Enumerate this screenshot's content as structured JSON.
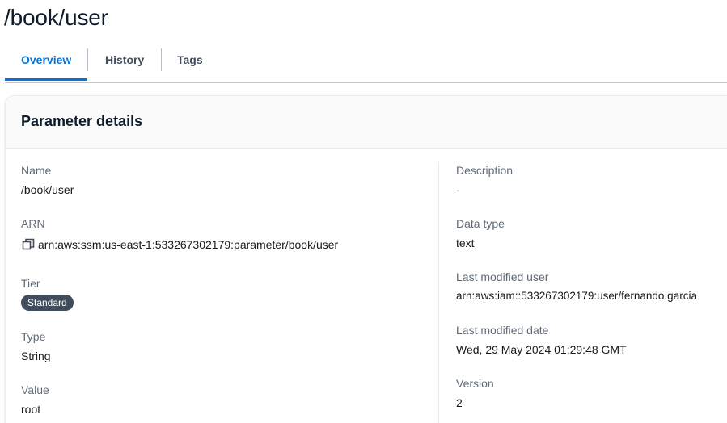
{
  "header": {
    "title": "/book/user"
  },
  "tabs": [
    {
      "label": "Overview",
      "active": true
    },
    {
      "label": "History",
      "active": false
    },
    {
      "label": "Tags",
      "active": false
    }
  ],
  "panel": {
    "title": "Parameter details"
  },
  "left_column": {
    "name": {
      "label": "Name",
      "value": "/book/user"
    },
    "arn": {
      "label": "ARN",
      "value": "arn:aws:ssm:us-east-1:533267302179:parameter/book/user",
      "icon": "copy-icon"
    },
    "tier": {
      "label": "Tier",
      "value": "Standard"
    },
    "type": {
      "label": "Type",
      "value": "String"
    },
    "value": {
      "label": "Value",
      "value": "root"
    }
  },
  "right_column": {
    "description": {
      "label": "Description",
      "value": "-"
    },
    "data_type": {
      "label": "Data type",
      "value": "text"
    },
    "last_modified_user": {
      "label": "Last modified user",
      "value": "arn:aws:iam::533267302179:user/fernando.garcia"
    },
    "last_modified_date": {
      "label": "Last modified date",
      "value": "Wed, 29 May 2024 01:29:48 GMT"
    },
    "version": {
      "label": "Version",
      "value": "2"
    }
  },
  "colors": {
    "accent": "#0972d3",
    "badge_background": "#414d5c",
    "label_text": "#5f6b7a"
  }
}
